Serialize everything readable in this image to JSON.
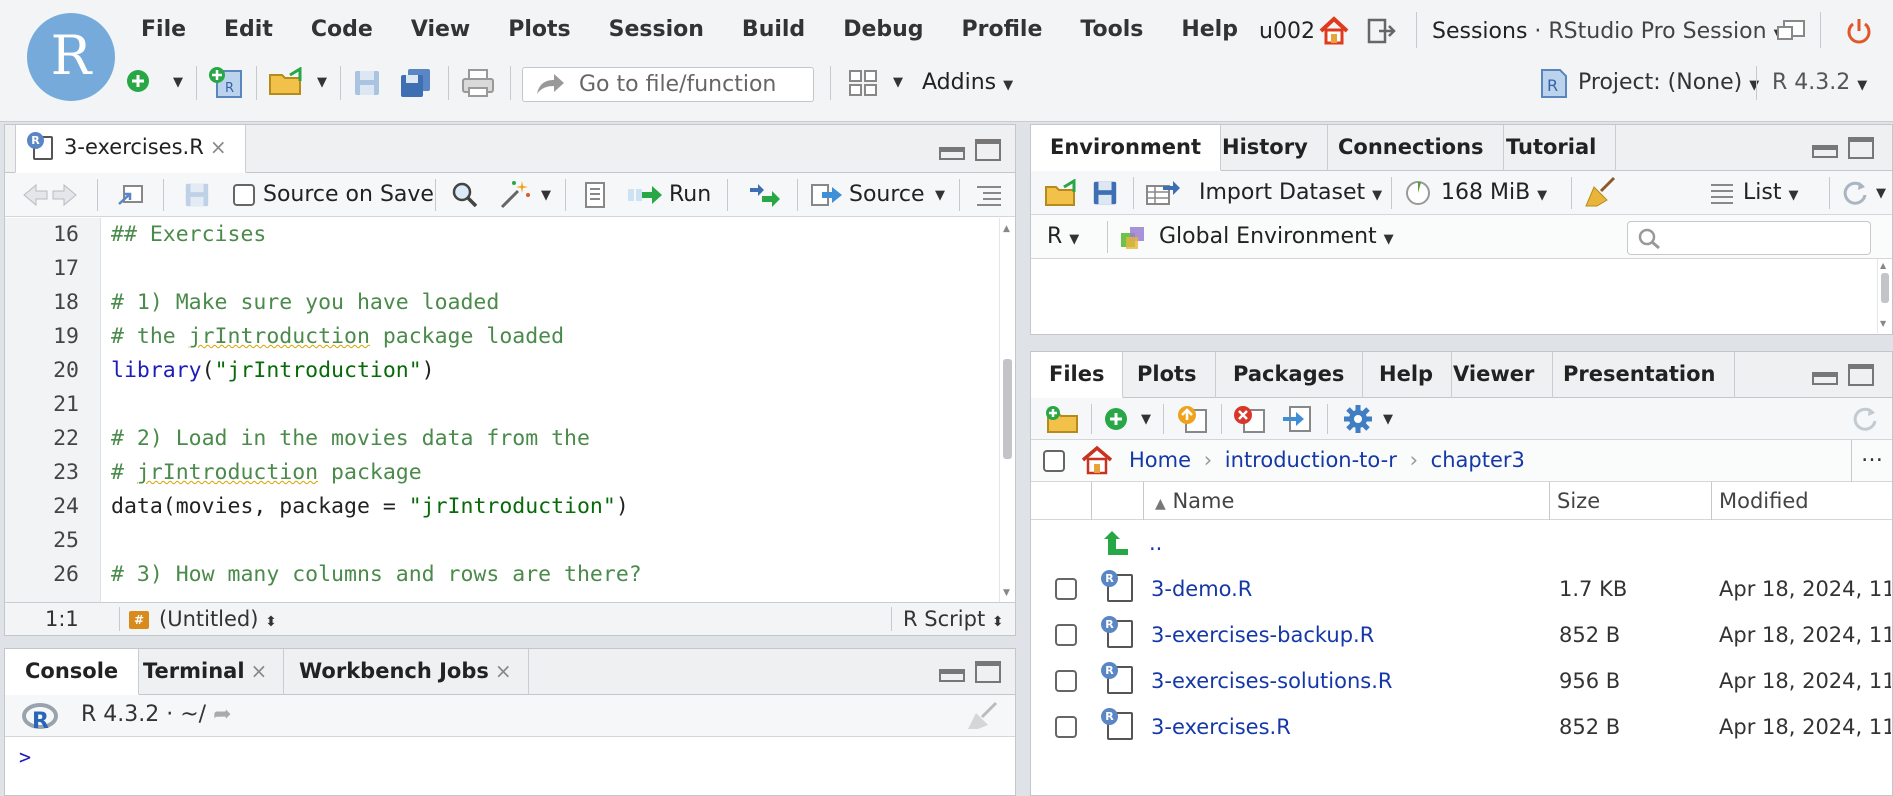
{
  "menu": {
    "items": [
      "File",
      "Edit",
      "Code",
      "View",
      "Plots",
      "Session",
      "Build",
      "Debug",
      "Profile",
      "Tools",
      "Help"
    ],
    "username": "u002",
    "sessions_label": "Sessions",
    "session_name": "· RStudio Pro Session"
  },
  "toolbar": {
    "goto_placeholder": "Go to file/function",
    "addins_label": "Addins",
    "project_label": "Project: (None)",
    "r_version": "R 4.3.2"
  },
  "editor": {
    "tab_label": "3-exercises.R",
    "source_on_save": "Source on Save",
    "run_label": "Run",
    "source_label": "Source",
    "lines": [
      {
        "n": "16",
        "segs": [
          {
            "t": "## Exercises",
            "c": "c-com"
          }
        ]
      },
      {
        "n": "17",
        "segs": []
      },
      {
        "n": "18",
        "segs": [
          {
            "t": "# 1) Make sure you have loaded",
            "c": "c-com"
          }
        ]
      },
      {
        "n": "19",
        "segs": [
          {
            "t": "# the ",
            "c": "c-com"
          },
          {
            "t": "jrIntroduction",
            "c": "c-com squig"
          },
          {
            "t": " package loaded",
            "c": "c-com"
          }
        ]
      },
      {
        "n": "20",
        "segs": [
          {
            "t": "library",
            "c": "c-fn"
          },
          {
            "t": "(",
            "c": "c-norm"
          },
          {
            "t": "\"jrIntroduction\"",
            "c": "c-str"
          },
          {
            "t": ")",
            "c": "c-norm"
          }
        ]
      },
      {
        "n": "21",
        "segs": []
      },
      {
        "n": "22",
        "segs": [
          {
            "t": "# 2) Load in the movies data from the",
            "c": "c-com"
          }
        ]
      },
      {
        "n": "23",
        "segs": [
          {
            "t": "# ",
            "c": "c-com"
          },
          {
            "t": "jrIntroduction",
            "c": "c-com squig"
          },
          {
            "t": " package",
            "c": "c-com"
          }
        ]
      },
      {
        "n": "24",
        "segs": [
          {
            "t": "data(movies, package = ",
            "c": "c-norm"
          },
          {
            "t": "\"jrIntroduction\"",
            "c": "c-str"
          },
          {
            "t": ")",
            "c": "c-norm"
          }
        ]
      },
      {
        "n": "25",
        "segs": []
      },
      {
        "n": "26",
        "segs": [
          {
            "t": "# 3) How many columns and rows are there?",
            "c": "c-com"
          }
        ]
      }
    ],
    "status_position": "1:1",
    "status_scope": "(Untitled)",
    "status_filetype": "R Script"
  },
  "console": {
    "tabs": [
      "Console",
      "Terminal",
      "Workbench Jobs"
    ],
    "r_version": "R 4.3.2",
    "path": "· ~/",
    "prompt": ">"
  },
  "environment": {
    "tabs": [
      "Environment",
      "History",
      "Connections",
      "Tutorial"
    ],
    "import_label": "Import Dataset",
    "memory": "168 MiB",
    "view_mode": "List",
    "language": "R",
    "scope": "Global Environment"
  },
  "files": {
    "tabs": [
      "Files",
      "Plots",
      "Packages",
      "Help",
      "Viewer",
      "Presentation"
    ],
    "breadcrumb": [
      "Home",
      "introduction-to-r",
      "chapter3"
    ],
    "columns": {
      "name": "Name",
      "size": "Size",
      "modified": "Modified"
    },
    "up_label": "..",
    "rows": [
      {
        "name": "3-demo.R",
        "size": "1.7 KB",
        "modified": "Apr 18, 2024, 11"
      },
      {
        "name": "3-exercises-backup.R",
        "size": "852 B",
        "modified": "Apr 18, 2024, 11"
      },
      {
        "name": "3-exercises-solutions.R",
        "size": "956 B",
        "modified": "Apr 18, 2024, 11"
      },
      {
        "name": "3-exercises.R",
        "size": "852 B",
        "modified": "Apr 18, 2024, 11"
      }
    ]
  }
}
